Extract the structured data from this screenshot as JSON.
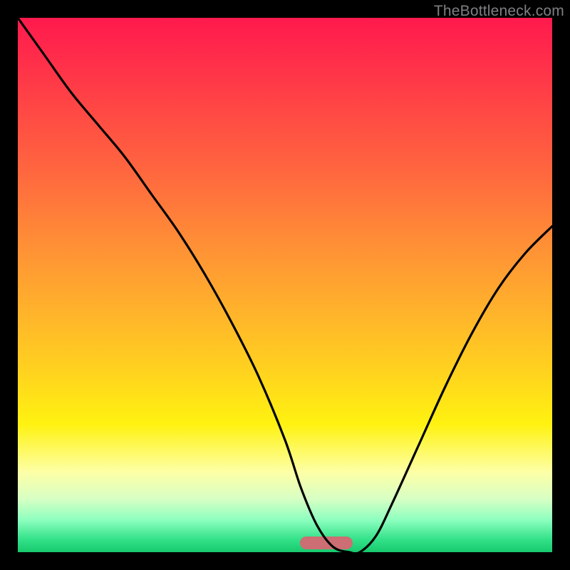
{
  "watermark": {
    "text": "TheBottleneck.com"
  },
  "chart_data": {
    "type": "line",
    "title": "",
    "xlabel": "",
    "ylabel": "",
    "xlim": [
      0,
      100
    ],
    "ylim": [
      0,
      100
    ],
    "grid": false,
    "background_gradient": [
      "#ff1a4d",
      "#ffd21f",
      "#17c96d"
    ],
    "series": [
      {
        "name": "bottleneck-curve",
        "x": [
          0,
          5,
          10,
          15,
          20,
          25,
          30,
          35,
          40,
          45,
          50,
          53,
          56,
          59,
          62,
          64,
          67,
          70,
          75,
          80,
          85,
          90,
          95,
          100
        ],
        "values": [
          100,
          93,
          86,
          80,
          74,
          67,
          60,
          52,
          43,
          33,
          21,
          12,
          5,
          1,
          0,
          0,
          3,
          9,
          20,
          31,
          41,
          49.5,
          56,
          61
        ]
      }
    ],
    "trough_marker": {
      "x_start": 58,
      "x_end": 68,
      "color": "#cc6e73"
    },
    "colors": {
      "curve": "#000000",
      "frame": "#000000"
    }
  }
}
